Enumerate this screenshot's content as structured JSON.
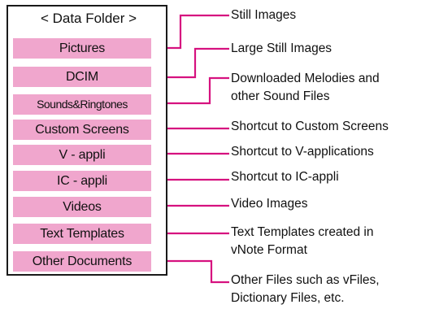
{
  "panel": {
    "title": "< Data Folder >"
  },
  "folders": [
    {
      "label": "Pictures",
      "description": [
        "Still Images"
      ]
    },
    {
      "label": "DCIM",
      "description": [
        "Large Still Images"
      ]
    },
    {
      "label": "Sounds&Ringtones",
      "description": [
        "Downloaded Melodies and",
        "other Sound Files"
      ]
    },
    {
      "label": "Custom Screens",
      "description": [
        "Shortcut to Custom Screens"
      ]
    },
    {
      "label": "V - appli",
      "description": [
        "Shortcut to V-applications"
      ]
    },
    {
      "label": "IC - appli",
      "description": [
        "Shortcut to IC-appli"
      ]
    },
    {
      "label": "Videos",
      "description": [
        "Video Images"
      ]
    },
    {
      "label": "Text Templates",
      "description": [
        "Text Templates created in",
        "vNote Format"
      ]
    },
    {
      "label": "Other Documents",
      "description": [
        "Other Files such as vFiles,",
        "Dictionary Files, etc."
      ]
    }
  ],
  "colors": {
    "folder_fill": "#f0a6cd",
    "connector": "#d6127f",
    "border": "#1a1a1a"
  }
}
